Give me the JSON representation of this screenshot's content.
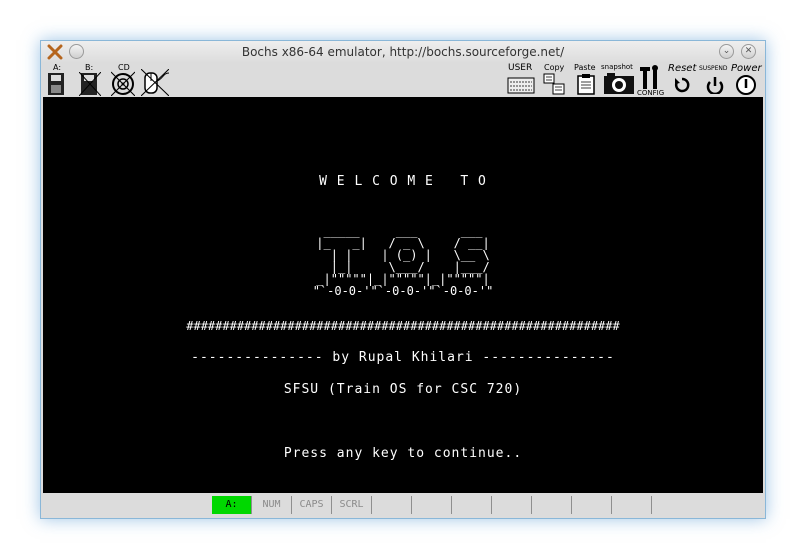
{
  "window": {
    "title": "Bochs x86-64 emulator, http://bochs.sourceforge.net/"
  },
  "toolbar": {
    "floppy_a_label": "A:",
    "floppy_b_label": "B:",
    "cdrom_label": "CD",
    "user_label": "USER",
    "copy_label": "Copy",
    "paste_label": "Paste",
    "snapshot_label": "snapshot",
    "config_label": "CONFIG",
    "reset_label": "Reset",
    "suspend_label": "SUSPEND",
    "power_label": "Power"
  },
  "screen": {
    "welcome": "W E L C O M E   T O",
    "ascii_logo": " _____     ___      ___ \n|_   _|   / _ \\    / __|\n  | |    | (_) |   \\__ \\\n  |_|     \\___/    |___/\n_|\"\"\"\"\"|_|\"\"\"\"\"|_|\"\"\"\"\"|\n\"`-0-0-'\"`-0-0-'\"`-0-0-'\"",
    "separator": "############################################################",
    "byline": "--------------- by Rupal Khilari ---------------",
    "subtitle": "SFSU (Train OS for CSC 720)",
    "prompt": "Press any key to continue.."
  },
  "status": {
    "cells": [
      "A:",
      "NUM",
      "CAPS",
      "SCRL",
      "",
      "",
      "",
      "",
      "",
      "",
      ""
    ],
    "active_index": 0,
    "active_color": "#00d800"
  }
}
